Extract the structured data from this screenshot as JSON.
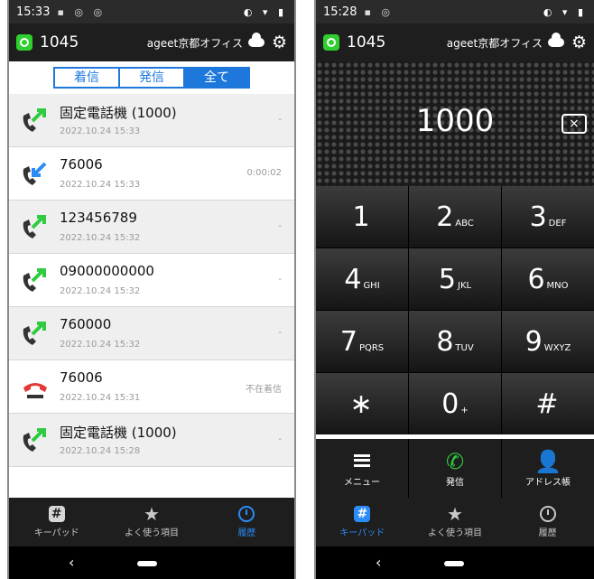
{
  "left": {
    "status": {
      "time": "15:33"
    },
    "appbar": {
      "extension": "1045",
      "office": "ageet京都オフィス"
    },
    "tabs": [
      {
        "label": "着信"
      },
      {
        "label": "発信"
      },
      {
        "label": "全て"
      }
    ],
    "history": [
      {
        "name": "固定電話機 (1000)",
        "date": "2022.10.24 15:33",
        "detail": "-",
        "type": "outgoing"
      },
      {
        "name": "76006",
        "date": "2022.10.24 15:33",
        "detail": "0:00:02",
        "type": "incoming"
      },
      {
        "name": "123456789",
        "date": "2022.10.24 15:32",
        "detail": "-",
        "type": "outgoing"
      },
      {
        "name": "09000000000",
        "date": "2022.10.24 15:32",
        "detail": "-",
        "type": "outgoing"
      },
      {
        "name": "760000",
        "date": "2022.10.24 15:32",
        "detail": "-",
        "type": "outgoing"
      },
      {
        "name": "76006",
        "date": "2022.10.24 15:31",
        "detail": "不在着信",
        "type": "missed"
      },
      {
        "name": "固定電話機 (1000)",
        "date": "2022.10.24 15:28",
        "detail": "-",
        "type": "outgoing"
      }
    ],
    "nav": {
      "keypad": "キーパッド",
      "favorites": "よく使う項目",
      "history": "履歴"
    }
  },
  "right": {
    "status": {
      "time": "15:28"
    },
    "appbar": {
      "extension": "1045",
      "office": "ageet京都オフィス"
    },
    "dialed_number": "1000",
    "keys": [
      {
        "digit": "1",
        "letters": ""
      },
      {
        "digit": "2",
        "letters": "ABC"
      },
      {
        "digit": "3",
        "letters": "DEF"
      },
      {
        "digit": "4",
        "letters": "GHI"
      },
      {
        "digit": "5",
        "letters": "JKL"
      },
      {
        "digit": "6",
        "letters": "MNO"
      },
      {
        "digit": "7",
        "letters": "PQRS"
      },
      {
        "digit": "8",
        "letters": "TUV"
      },
      {
        "digit": "9",
        "letters": "WXYZ"
      },
      {
        "digit": "∗",
        "letters": ""
      },
      {
        "digit": "0",
        "letters": "+"
      },
      {
        "digit": "#",
        "letters": ""
      }
    ],
    "actions": {
      "menu": "メニュー",
      "call": "発信",
      "contacts": "アドレス帳"
    },
    "nav": {
      "keypad": "キーパッド",
      "favorites": "よく使う項目",
      "history": "履歴"
    }
  },
  "colors": {
    "accent": "#1e78dc",
    "active_nav": "#2b8cf5",
    "outgoing_arrow": "#2ecc40",
    "incoming_arrow": "#2b8cf5",
    "missed": "#e53935"
  }
}
